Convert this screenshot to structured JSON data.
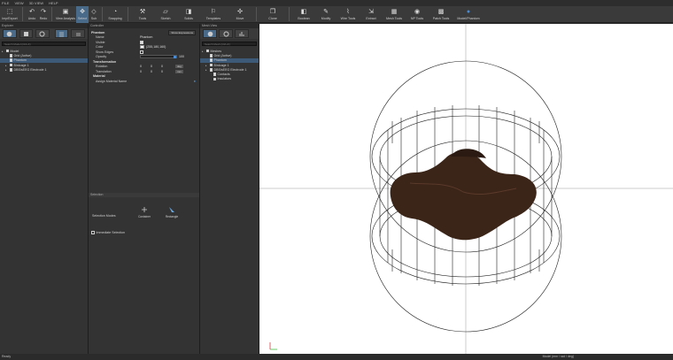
{
  "menu": [
    "FILE",
    "VIEW",
    "3D VIEW",
    "HELP"
  ],
  "toolbar": {
    "items": [
      {
        "id": "import",
        "label": "Imp/Export",
        "icon": "import-export-icon"
      },
      {
        "id": "undo",
        "label": "Undo",
        "icon": "undo-icon"
      },
      {
        "id": "redo",
        "label": "Redo",
        "icon": "redo-icon"
      },
      {
        "id": "view",
        "label": "View Analysis",
        "icon": "view-analysis-icon"
      },
      {
        "id": "select",
        "label": "Select",
        "icon": "select-icon"
      },
      {
        "id": "sub",
        "label": "Sub",
        "icon": "sub-icon"
      },
      {
        "id": "snap",
        "label": "Snapping",
        "icon": "snapping-icon"
      },
      {
        "id": "tools",
        "label": "Tools",
        "icon": "tools-icon"
      },
      {
        "id": "sketch",
        "label": "Sketch",
        "icon": "sketch-icon"
      },
      {
        "id": "solids",
        "label": "Solids",
        "icon": "solids-icon"
      },
      {
        "id": "templates",
        "label": "Templates",
        "icon": "templates-icon"
      },
      {
        "id": "move",
        "label": "Move",
        "icon": "move-icon"
      },
      {
        "id": "clone",
        "label": "Clone",
        "icon": "clone-icon"
      },
      {
        "id": "boolean",
        "label": "Boolean",
        "icon": "boolean-icon"
      },
      {
        "id": "modify",
        "label": "Modify",
        "icon": "modify-icon"
      },
      {
        "id": "wire",
        "label": "Wire Tools",
        "icon": "wire-tools-icon"
      },
      {
        "id": "extract",
        "label": "Extract",
        "icon": "extract-icon"
      },
      {
        "id": "mesh",
        "label": "Mesh Tools",
        "icon": "mesh-tools-icon"
      },
      {
        "id": "np",
        "label": "NP Tools",
        "icon": "np-tools-icon"
      },
      {
        "id": "patch",
        "label": "Patch Tools",
        "icon": "patch-tools-icon"
      },
      {
        "id": "phantom",
        "label": "Model/Phantom",
        "icon": "phantom-icon"
      }
    ]
  },
  "explorer": {
    "title": "Explorer",
    "search_placeholder": "Search Model (Ctrl+F)",
    "items": [
      {
        "label": "Model",
        "level": 0
      },
      {
        "label": "Grid (Active)",
        "level": 1
      },
      {
        "label": "Phantom",
        "level": 1,
        "selected": true
      },
      {
        "label": "Birdcage 1",
        "level": 1
      },
      {
        "label": "DBS/sEEG Electrode 1",
        "level": 1
      }
    ]
  },
  "controller": {
    "title": "Controller",
    "object": "Phantom",
    "show_expressions": "Show Expressions",
    "rows": {
      "name_label": "Name",
      "name_value": "Phantom",
      "visible_label": "Visible",
      "color_label": "Color",
      "color_value": "(255,180,160)",
      "show_edges_label": "Show Edges",
      "opacity_label": "Opacity",
      "opacity_value": "100"
    },
    "transformation": "Transformation",
    "rotation_label": "Rotation",
    "rotation": [
      "0",
      "0",
      "0"
    ],
    "rotation_unit": "deg",
    "translation_label": "Translation",
    "translation": [
      "0",
      "0",
      "0"
    ],
    "translation_unit": "mm",
    "material": "Material",
    "assign_label": "Assign Material Name"
  },
  "selection": {
    "title": "Selection",
    "modes_label": "Selection Modes",
    "modes": [
      "Container",
      "Rectangle"
    ],
    "immediate": "Immediate Selection"
  },
  "mesh_view": {
    "title": "Mesh View",
    "search_placeholder": "Search Mesh (Ctrl+F)",
    "items": [
      {
        "label": "Meshes",
        "level": 0
      },
      {
        "label": "Grid (Active)",
        "level": 1
      },
      {
        "label": "Phantom",
        "level": 1,
        "selected": true
      },
      {
        "label": "Birdcage 1",
        "level": 1
      },
      {
        "label": "DBS/sEEG Electrode 1",
        "level": 1
      },
      {
        "label": "Contacts",
        "level": 2
      },
      {
        "label": "Insulators",
        "level": 2
      }
    ]
  },
  "status": {
    "left": "Ready",
    "right": "Model (mm / rad / deg)"
  },
  "colors": {
    "accent": "#4a6a8a",
    "phantom": "#3b2418",
    "selected": "#3d5a78"
  }
}
